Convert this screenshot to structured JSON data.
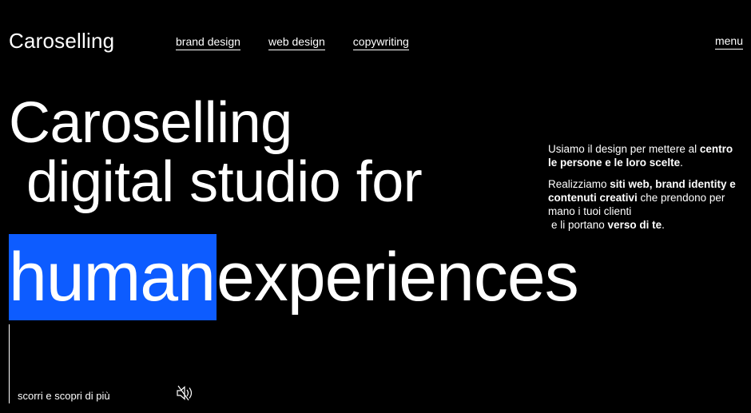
{
  "header": {
    "logo": "Caroselling",
    "nav": [
      {
        "label": "brand design"
      },
      {
        "label": "web design"
      },
      {
        "label": "copywriting"
      }
    ],
    "menu_label": "menu"
  },
  "hero": {
    "line1": "Caroselling",
    "line2": "digital studio for",
    "highlight": "human",
    "line3_rest": "experiences",
    "highlight_color": "#0d5cff"
  },
  "description": {
    "p1_a": "Usiamo il design per mettere al ",
    "p1_b": "centro le persone e le loro scelte",
    "p1_c": ".",
    "p2_a": "Realizziamo ",
    "p2_b": "siti web, brand identity e contenuti creativi",
    "p2_c": " che prendono per mano i tuoi clienti",
    "p2_d": "e li portano ",
    "p2_e": "verso di te",
    "p2_f": "."
  },
  "footer": {
    "scroll_hint": "scorri e scopri di più",
    "sound_icon": "sound-muted-icon"
  },
  "colors": {
    "background": "#000000",
    "text": "#ffffff",
    "accent": "#0d5cff"
  }
}
